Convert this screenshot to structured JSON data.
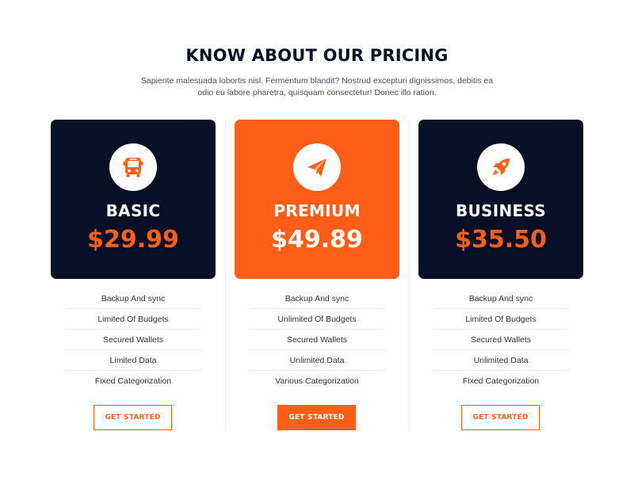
{
  "section": {
    "title": "KNOW ABOUT OUR PRICING",
    "subtitle": "Sapiente malesuada lobortis nisl. Fermentum blandit? Nostrud excepturi dignissimos, debitis ea odio eu labore pharetra, quisquam consectetur! Donec illo ration."
  },
  "colors": {
    "accent": "#fe5e16",
    "dark": "#060f26",
    "heading": "#0b1024"
  },
  "plans": [
    {
      "name": "BASIC",
      "price": "$29.99",
      "icon": "bus-icon",
      "features": [
        "Backup And sync",
        "Limited Of Budgets",
        "Secured Wallets",
        "Limited Data",
        "Fixed Categorization"
      ],
      "button_label": "GET STARTED"
    },
    {
      "name": "PREMIUM",
      "price": "$49.89",
      "icon": "paper-plane-icon",
      "features": [
        "Backup And sync",
        "Unlimited Of Budgets",
        "Secured Wallets",
        "Unlimited Data",
        "Various Categorization"
      ],
      "button_label": "GET STARTED"
    },
    {
      "name": "BUSINESS",
      "price": "$35.50",
      "icon": "rocket-icon",
      "features": [
        "Backup And sync",
        "Limited Of Budgets",
        "Secured Wallets",
        "Unlimited Data",
        "Fixed Categorization"
      ],
      "button_label": "GET STARTED"
    }
  ]
}
